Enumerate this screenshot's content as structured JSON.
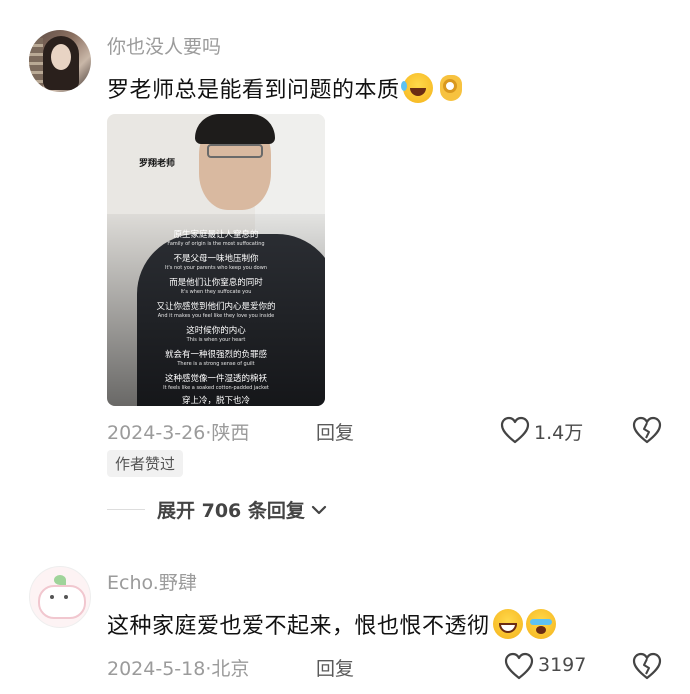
{
  "comments": [
    {
      "username": "你也没人要吗",
      "text": "罗老师总是能看到问题的本质",
      "emojis": [
        "laughing-tears-emoji",
        "ok-hand-emoji"
      ],
      "date": "2024-3-26",
      "location": "陕西",
      "reply_label": "回复",
      "likes": "1.4万",
      "badge": "作者赞过",
      "image": {
        "tag": "罗翔老师",
        "subtitles": [
          {
            "zh": "原生家庭最让人窒息的",
            "en": "Family of origin is the most suffocating"
          },
          {
            "zh": "不是父母一味地压制你",
            "en": "It's not your parents who keep you down"
          },
          {
            "zh": "而是他们让你窒息的同时",
            "en": "It's when they suffocate you"
          },
          {
            "zh": "又让你感觉到他们内心是爱你的",
            "en": "And it makes you feel like they love you inside"
          },
          {
            "zh": "这时候你的内心",
            "en": "This is when your heart"
          },
          {
            "zh": "就会有一种很强烈的负罪感",
            "en": "There is a strong sense of guilt"
          },
          {
            "zh": "这种感觉像一件湿透的棉袄",
            "en": "It feels like a soaked cotton-padded jacket"
          },
          {
            "zh": "穿上冷，脱下也冷",
            "en": ""
          }
        ]
      }
    },
    {
      "username": "Echo.野肆",
      "text": "这种家庭爱也爱不起来，恨也恨不透彻",
      "emojis": [
        "grinning-sweat-emoji",
        "crying-emoji"
      ],
      "date": "2024-5-18",
      "location": "北京",
      "reply_label": "回复",
      "likes": "3197"
    }
  ],
  "expand_replies": "展开 706 条回复",
  "separator": "·"
}
